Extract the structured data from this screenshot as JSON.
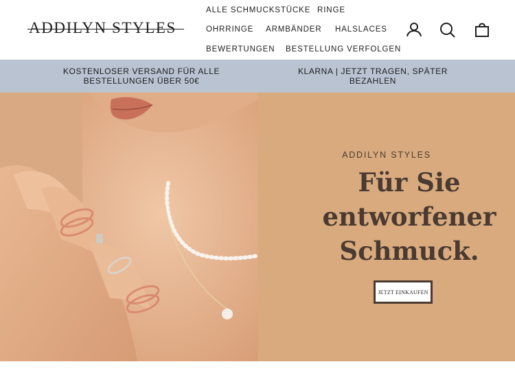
{
  "header": {
    "logo": "ADDILYN STYLES",
    "nav": {
      "all_jewelry": "ALLE SCHMUCKSTÜCKE",
      "rings": "RINGE",
      "earrings": "OHRRINGE",
      "bracelets": "ARMBÄNDER",
      "necklaces": "HALSLACES",
      "reviews": "BEWERTUNGEN",
      "track_order": "BESTELLUNG VERFOLGEN"
    },
    "icons": [
      "account-icon",
      "search-icon",
      "cart-icon"
    ]
  },
  "announcement": {
    "shipping": "KOSTENLOSER VERSAND FÜR ALLE BESTELLUNGEN ÜBER 50€",
    "klarna": "KLARNA | JETZT TRAGEN, SPÄTER BEZAHLEN",
    "background": "#b9c3d2"
  },
  "hero": {
    "kicker": "ADDILYN STYLES",
    "title": "Für Sie entworfener Schmuck.",
    "cta": "JETZT EINKAUFEN",
    "panel_color": "#d8aa7d",
    "text_color": "#4a3a31"
  }
}
